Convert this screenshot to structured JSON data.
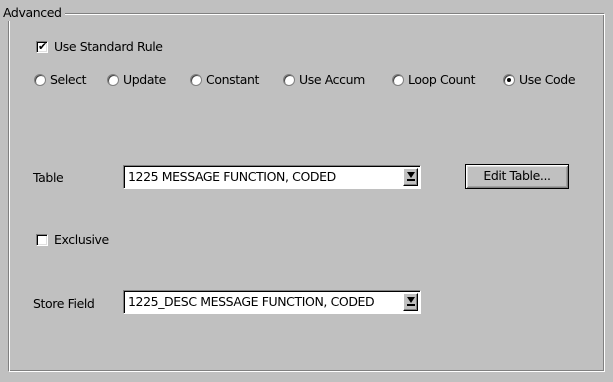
{
  "group": {
    "title": "Advanced"
  },
  "use_standard_rule": {
    "label": "Use Standard Rule",
    "checked": true
  },
  "rule_options": [
    {
      "label": "Select",
      "selected": false
    },
    {
      "label": "Update",
      "selected": false
    },
    {
      "label": "Constant",
      "selected": false
    },
    {
      "label": "Use Accum",
      "selected": false
    },
    {
      "label": "Loop Count",
      "selected": false
    },
    {
      "label": "Use Code",
      "selected": true
    }
  ],
  "table": {
    "label": "Table",
    "value": "1225 MESSAGE FUNCTION, CODED"
  },
  "edit_table_button": {
    "label": "Edit Table..."
  },
  "exclusive": {
    "label": "Exclusive",
    "checked": false
  },
  "store_field": {
    "label": "Store Field",
    "value": "1225_DESC MESSAGE FUNCTION, CODED"
  }
}
